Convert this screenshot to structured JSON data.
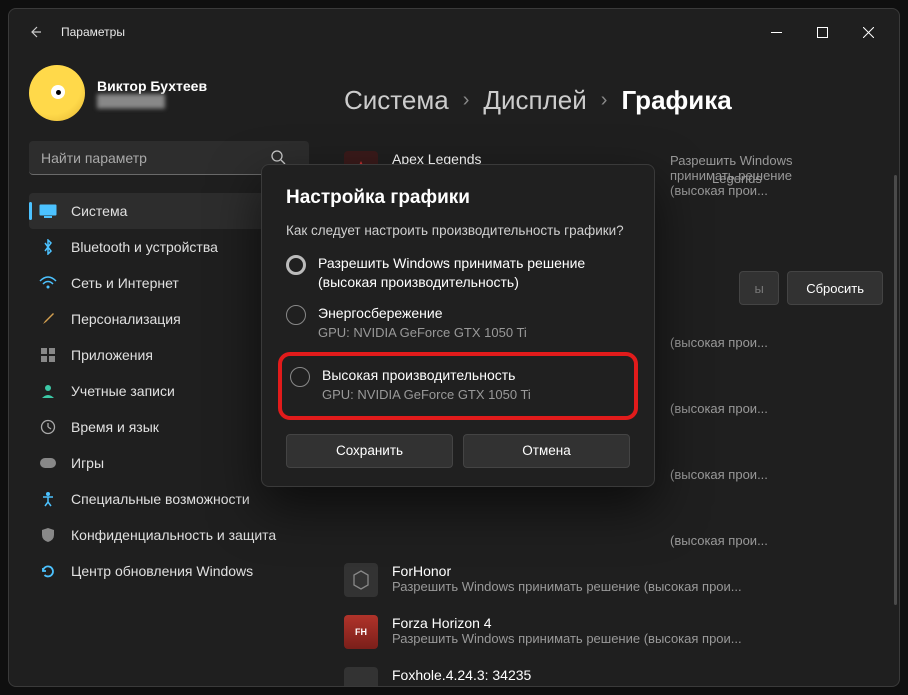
{
  "window": {
    "title": "Параметры"
  },
  "user": {
    "name": "Виктор Бухтеев",
    "email": "hidden"
  },
  "search": {
    "placeholder": "Найти параметр"
  },
  "nav": [
    {
      "label": "Система",
      "icon": "🖥️"
    },
    {
      "label": "Bluetooth и устройства",
      "icon": "bt"
    },
    {
      "label": "Сеть и Интернет",
      "icon": "wifi"
    },
    {
      "label": "Персонализация",
      "icon": "brush"
    },
    {
      "label": "Приложения",
      "icon": "apps"
    },
    {
      "label": "Учетные записи",
      "icon": "user"
    },
    {
      "label": "Время и язык",
      "icon": "clock"
    },
    {
      "label": "Игры",
      "icon": "game"
    },
    {
      "label": "Специальные возможности",
      "icon": "accessibility"
    },
    {
      "label": "Конфиденциальность и защита",
      "icon": "shield"
    },
    {
      "label": "Центр обновления Windows",
      "icon": "update"
    }
  ],
  "breadcrumbs": [
    "Система",
    "Дисплей",
    "Графика"
  ],
  "buttons": {
    "options": "Параметры",
    "reset": "Сбросить"
  },
  "apps": [
    {
      "name": "Apex Legends",
      "sub": "Разрешить Windows принимать решение (высокая прои...",
      "extra": "Legends"
    },
    {
      "name": "",
      "sub": "(высокая прои..."
    },
    {
      "name": "",
      "sub": "(высокая прои..."
    },
    {
      "name": "",
      "sub": "(высокая прои..."
    },
    {
      "name": "",
      "sub": "(высокая прои..."
    },
    {
      "name": "ForHonor",
      "sub": "Разрешить Windows принимать решение (высокая прои..."
    },
    {
      "name": "Forza Horizon 4",
      "sub": "Разрешить Windows принимать решение (высокая прои..."
    },
    {
      "name": "Foxhole.4.24.3: 34235",
      "sub": ""
    }
  ],
  "dialog": {
    "title": "Настройка графики",
    "question": "Как следует настроить производительность графики?",
    "opt1": "Разрешить Windows принимать решение (высокая производительность)",
    "opt2": "Энергосбережение",
    "opt2g": "GPU: NVIDIA GeForce GTX 1050 Ti",
    "opt3": "Высокая производительность",
    "opt3g": "GPU: NVIDIA GeForce GTX 1050 Ti",
    "save": "Сохранить",
    "cancel": "Отмена"
  }
}
